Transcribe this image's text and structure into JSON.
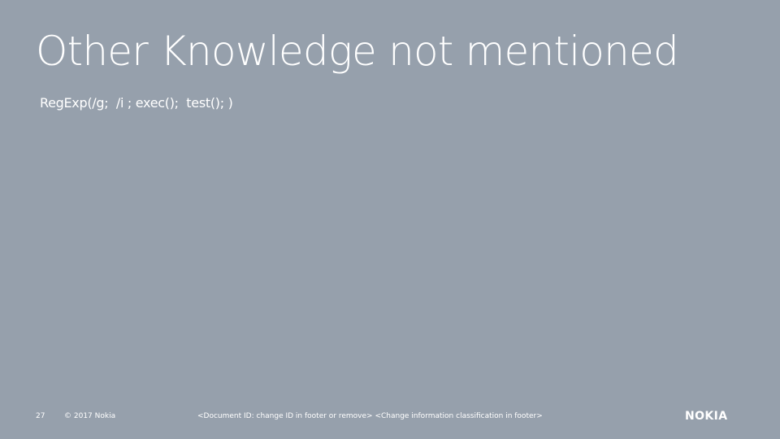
{
  "slide": {
    "title": "Other Knowledge not mentioned",
    "body": "RegExp(/g;  /i ; exec();  test(); )"
  },
  "footer": {
    "page_number": "27",
    "copyright": "© 2017 Nokia",
    "document_info": "<Document ID: change ID in footer or remove> <Change information classification in footer>"
  },
  "logo": {
    "text": "NOKIA"
  },
  "colors": {
    "background": "#96a0ac",
    "text": "#ffffff"
  }
}
